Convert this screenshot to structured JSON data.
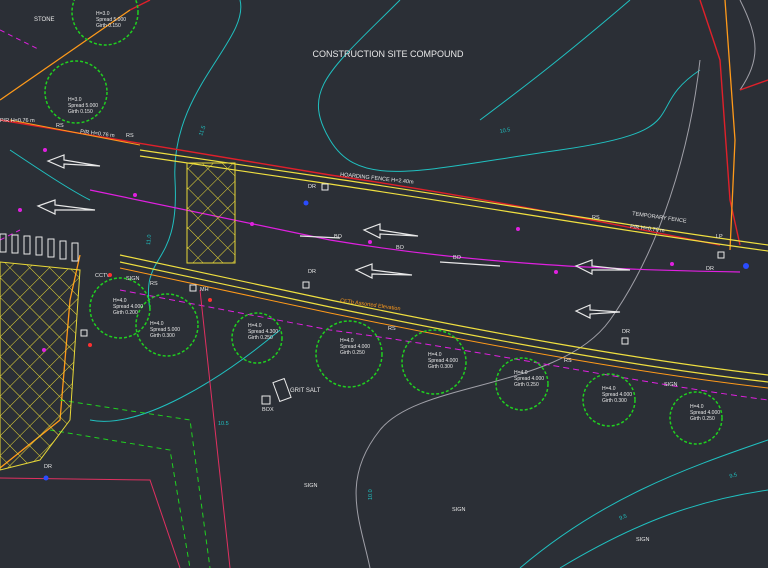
{
  "title": "CONSTRUCTION SITE COMPOUND",
  "labels": {
    "stone": "STONE",
    "hoarding_fence": "HOARDING FENCE H=2.40m",
    "temporary_fence": "TEMPORARY FENCE",
    "pr_hfence_top": "P/R H=0.76 m",
    "pr_hfence_right": "P/R H=0.76 m",
    "pr_left": "P/R H=0.76 m",
    "grit_salt": "GRIT SALT",
    "box": "BOX",
    "cctv": "CCTV",
    "mh": "MH",
    "dr": "DR",
    "rs": "RS",
    "bo": "BO",
    "lp": "LP",
    "sign": "SIGN",
    "kerb": "CFTb Assorted Elevation"
  },
  "trees": [
    {
      "h": "H=3.0",
      "spread": "Spread 5.000",
      "girth": "Girth 0.150"
    },
    {
      "h": "H=3.0",
      "spread": "Spread 5.000",
      "girth": "Girth 0.150"
    },
    {
      "h": "H=4.0",
      "spread": "Spread 4.000",
      "girth": "Girth 0.200"
    },
    {
      "h": "H=4.0",
      "spread": "Spread 5.000",
      "girth": "Girth 0.300"
    },
    {
      "h": "H=4.0",
      "spread": "Spread 4.300",
      "girth": "Girth 0.250"
    },
    {
      "h": "H=4.0",
      "spread": "Spread 4.000",
      "girth": "Girth 0.250"
    },
    {
      "h": "H=4.0",
      "spread": "Spread 4.000",
      "girth": "Girth 0.300"
    },
    {
      "h": "H=4.0",
      "spread": "Spread 4.000",
      "girth": "Girth 0.250"
    },
    {
      "h": "H=4.0",
      "spread": "Spread 4.000",
      "girth": "Girth 0.300"
    },
    {
      "h": "H=4.0",
      "spread": "Spread 4.000",
      "girth": "Girth 0.250"
    }
  ],
  "levels": [
    "11.5",
    "11.0",
    "10.5",
    "10.0",
    "9.5"
  ],
  "colors": {
    "bg": "#2b2f36",
    "road_edge": "#f0e040",
    "kerb": "#ff9a1a",
    "fence": "#e0202a",
    "contour": "#20c0c0",
    "tree": "#20d020",
    "magenta": "#e020e0",
    "grey": "#a0a0a8"
  }
}
